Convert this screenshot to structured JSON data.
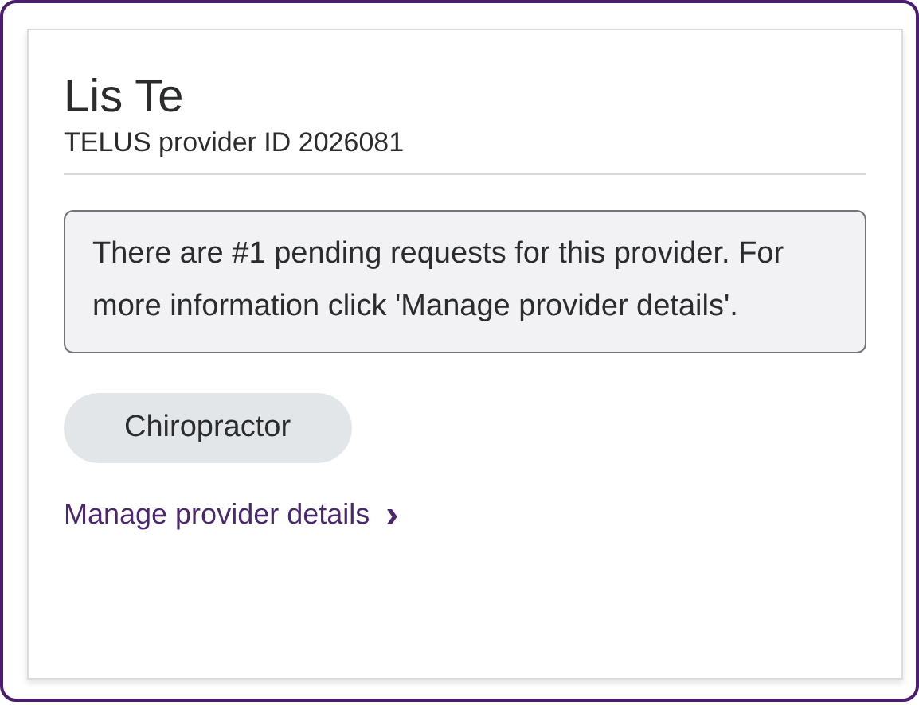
{
  "provider": {
    "name": "Lis Te",
    "provider_id": "TELUS provider ID 2026081"
  },
  "notice": "There are #1 pending requests for this provider. For more information click 'Manage provider details'.",
  "tags": [
    "Chiropractor"
  ],
  "link": {
    "label": "Manage provider details",
    "icon": "›"
  }
}
